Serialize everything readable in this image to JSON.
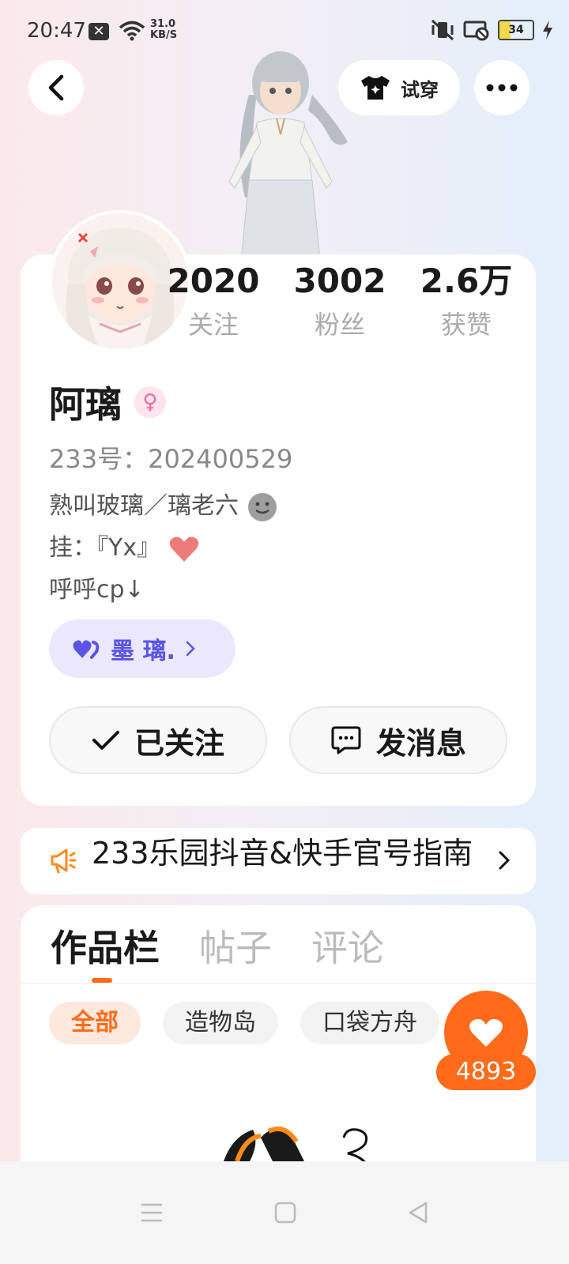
{
  "status_bar": {
    "time": "20:47",
    "speed_value": "31.0",
    "speed_unit": "KB/S",
    "battery": "34"
  },
  "top_bar": {
    "try_on_label": "试穿"
  },
  "stats": [
    {
      "value": "2020",
      "label": "关注"
    },
    {
      "value": "3002",
      "label": "粉丝"
    },
    {
      "value": "2.6万",
      "label": "获赞"
    }
  ],
  "profile": {
    "name": "阿璃",
    "uid": "233号：202400529",
    "bio_line1": "熟叫玻璃／璃老六",
    "bio_line2": "挂：『Yx』",
    "bio_line3": "呼呼cp↓",
    "cp_name": "墨 璃.",
    "follow_label": "已关注",
    "message_label": "发消息"
  },
  "notice": {
    "text": "233乐园抖音&快手官号指南"
  },
  "tabs": [
    "作品栏",
    "帖子",
    "评论"
  ],
  "chips": [
    "全部",
    "造物岛",
    "口袋方舟"
  ],
  "likes": {
    "count": "4893"
  },
  "colors": {
    "accent": "#ff6b1a",
    "cp_purple": "#5b54e6"
  }
}
